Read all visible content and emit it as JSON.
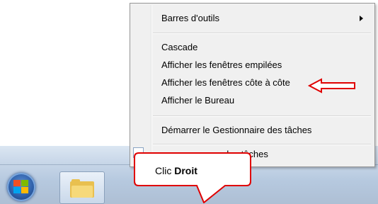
{
  "menu": {
    "items": [
      {
        "label": "Barres d'outils"
      },
      {
        "label": "Cascade"
      },
      {
        "label": "Afficher les fenêtres empilées"
      },
      {
        "label": "Afficher les fenêtres côte à côte"
      },
      {
        "label": "Afficher le Bureau"
      },
      {
        "label": "Démarrer le Gestionnaire des tâches"
      },
      {
        "label": "des tâches"
      }
    ]
  },
  "callout": {
    "prefix": "Clic ",
    "bold": "Droit"
  },
  "colors": {
    "annotation": "#e00000",
    "menu_bg": "#f0f0f0",
    "taskbar": "#c7d6e8"
  },
  "icons": [
    "windows-start-icon",
    "folder-icon",
    "submenu-arrow-icon",
    "red-pointer-arrow-icon"
  ]
}
